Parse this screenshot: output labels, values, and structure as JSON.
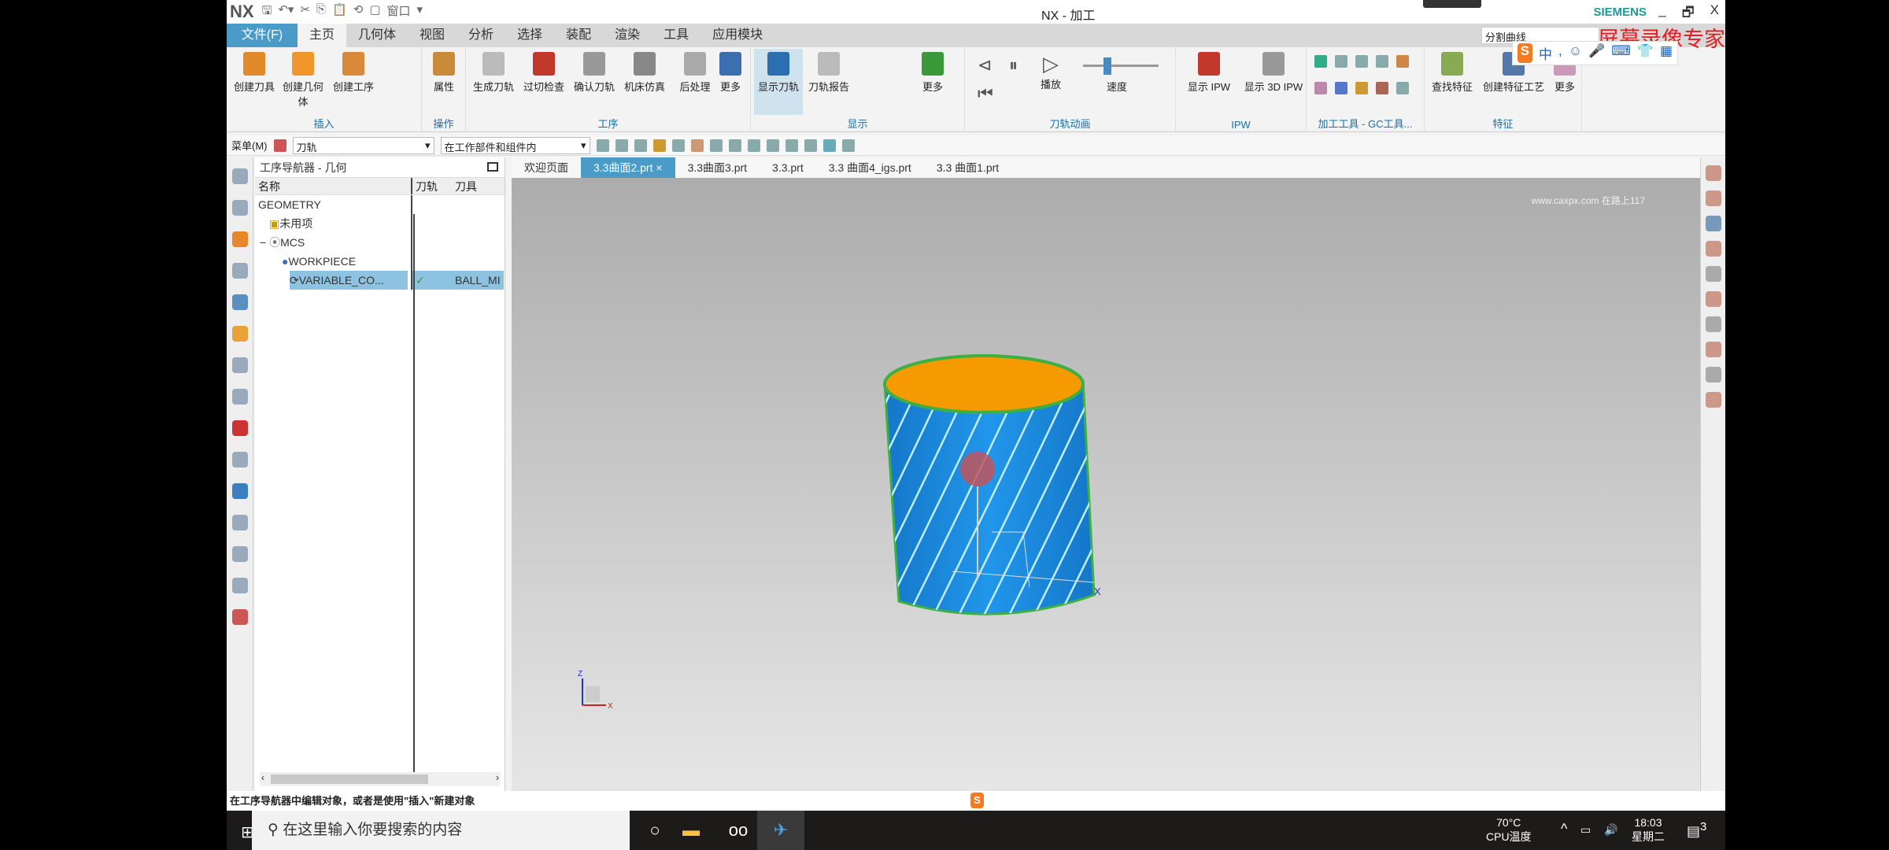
{
  "title_bar": {
    "logo": "NX",
    "title": "NX - 加工",
    "brand": "SIEMENS",
    "window_label": "窗口",
    "controls": [
      "_",
      "🗗",
      "X"
    ]
  },
  "menu": {
    "file": "文件(F)",
    "tabs": [
      "主页",
      "几何体",
      "视图",
      "分析",
      "选择",
      "装配",
      "渲染",
      "工具",
      "应用模块"
    ],
    "active": "主页",
    "search_value": "分割曲线"
  },
  "recorder_watermark": "屏幕录像专家",
  "ime": {
    "logo": "S",
    "mode": "中"
  },
  "ribbon": {
    "groups": [
      {
        "label": "插入",
        "buttons": [
          "创建刀具",
          "创建几何体",
          "创建工序"
        ]
      },
      {
        "label": "操作",
        "buttons": [
          "属性"
        ]
      },
      {
        "label": "工序",
        "buttons": [
          "生成刀轨",
          "过切检查",
          "确认刀轨",
          "机床仿真",
          "后处理",
          "更多"
        ]
      },
      {
        "label": "显示",
        "buttons": [
          "显示刀轨",
          "刀轨报告",
          "更多"
        ]
      },
      {
        "label": "刀轨动画",
        "buttons": [
          "播放",
          "速度"
        ]
      },
      {
        "label": "IPW",
        "buttons": [
          "显示 IPW",
          "显示 3D IPW"
        ]
      },
      {
        "label": "加工工具 - GC工具...",
        "buttons": []
      },
      {
        "label": "特征",
        "buttons": [
          "查找特征",
          "创建特征工艺",
          "更多"
        ]
      }
    ],
    "selected_button": "显示刀轨",
    "speed_level": 0.3
  },
  "toolbar": {
    "menu": "菜单(M)",
    "filter": "刀轨",
    "scope": "在工作部件和组件内"
  },
  "navigator": {
    "title": "工序导航器 - 几何",
    "columns": [
      "名称",
      "刀轨",
      "刀具"
    ],
    "rows": [
      {
        "name": "GEOMETRY",
        "path": "",
        "tool": ""
      },
      {
        "name": "未用项",
        "path": "",
        "tool": ""
      },
      {
        "name": "MCS",
        "path": "",
        "tool": ""
      },
      {
        "name": "WORKPIECE",
        "path": "",
        "tool": ""
      },
      {
        "name": "VARIABLE_CO...",
        "path": "✓",
        "tool": "BALL_MI"
      }
    ]
  },
  "file_tabs": [
    "欢迎页面",
    "3.3曲面2.prt",
    "3.3曲面3.prt",
    "3.3.prt",
    "3.3 曲面4_igs.prt",
    "3.3 曲面1.prt"
  ],
  "active_file_tab": "3.3曲面2.prt",
  "viewport": {
    "watermark": "www.caxpx.com 在路上117",
    "axis_x": "X",
    "axis_z": "Z",
    "colors": {
      "surface": "#1e8fe0",
      "top": "#f59a00",
      "edge": "#3cb043",
      "toolpath": "#bfefff"
    }
  },
  "status_bar": {
    "text": "在工序导航器中编辑对象，或者是使用\"插入\"新建对象"
  },
  "taskbar": {
    "search_placeholder": "在这里输入你要搜索的内容",
    "cpu_temp": "70°C",
    "cpu_label": "CPU温度",
    "time": "18:03",
    "day": "星期二",
    "notifications": "3"
  }
}
